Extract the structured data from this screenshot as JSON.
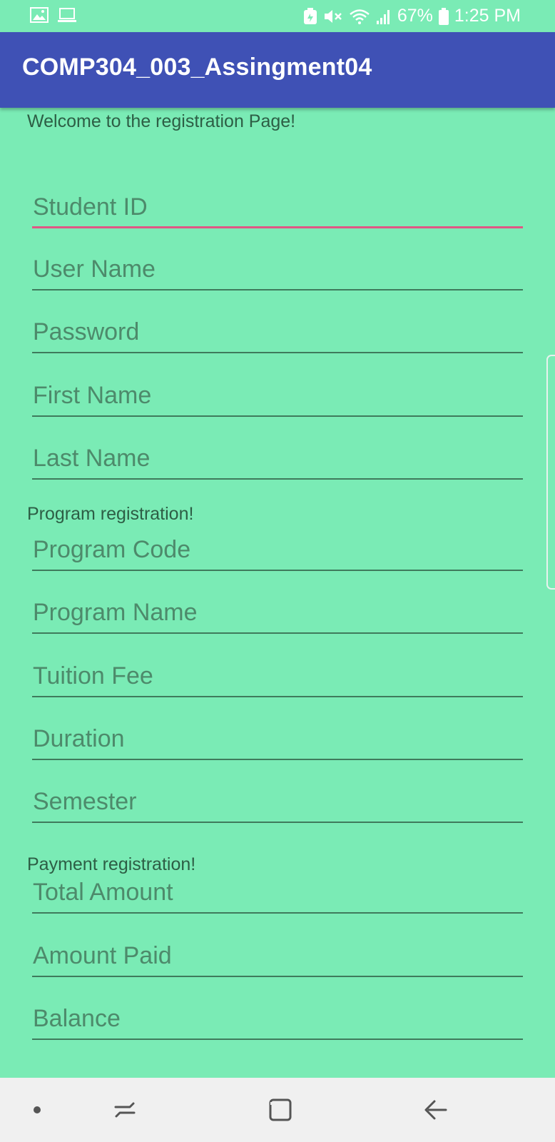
{
  "status_bar": {
    "battery_percent": "67%",
    "time": "1:25 PM",
    "left_icons": [
      "image-icon",
      "laptop-icon"
    ],
    "right_icons": [
      "battery-saver-icon",
      "mute-icon",
      "wifi-icon",
      "signal-icon",
      "battery-icon"
    ]
  },
  "app_bar": {
    "title": "COMP304_003_Assingment04",
    "color": "#3f51b5"
  },
  "welcome_text": "Welcome to the registration Page!",
  "student_fields": [
    {
      "placeholder": "Student ID",
      "value": "",
      "focused": true
    },
    {
      "placeholder": "User Name",
      "value": ""
    },
    {
      "placeholder": "Password",
      "value": ""
    },
    {
      "placeholder": "First Name",
      "value": ""
    },
    {
      "placeholder": "Last Name",
      "value": ""
    }
  ],
  "program_section_title": "Program registration!",
  "program_fields": [
    {
      "placeholder": "Program Code",
      "value": ""
    },
    {
      "placeholder": "Program Name",
      "value": ""
    },
    {
      "placeholder": "Tuition Fee",
      "value": ""
    },
    {
      "placeholder": "Duration",
      "value": ""
    },
    {
      "placeholder": "Semester",
      "value": ""
    }
  ],
  "payment_section_title": "Payment registration!",
  "payment_fields": [
    {
      "placeholder": "Total Amount",
      "value": ""
    },
    {
      "placeholder": "Amount Paid",
      "value": ""
    },
    {
      "placeholder": "Balance",
      "value": ""
    }
  ],
  "nav_bar": {
    "buttons": [
      "dot-icon",
      "recents-icon",
      "home-icon",
      "back-icon"
    ]
  },
  "colors": {
    "background": "#7aebb5",
    "focus_underline": "#e05784",
    "underline": "#3f7a5c",
    "hint_text": "#4d8a6b"
  }
}
